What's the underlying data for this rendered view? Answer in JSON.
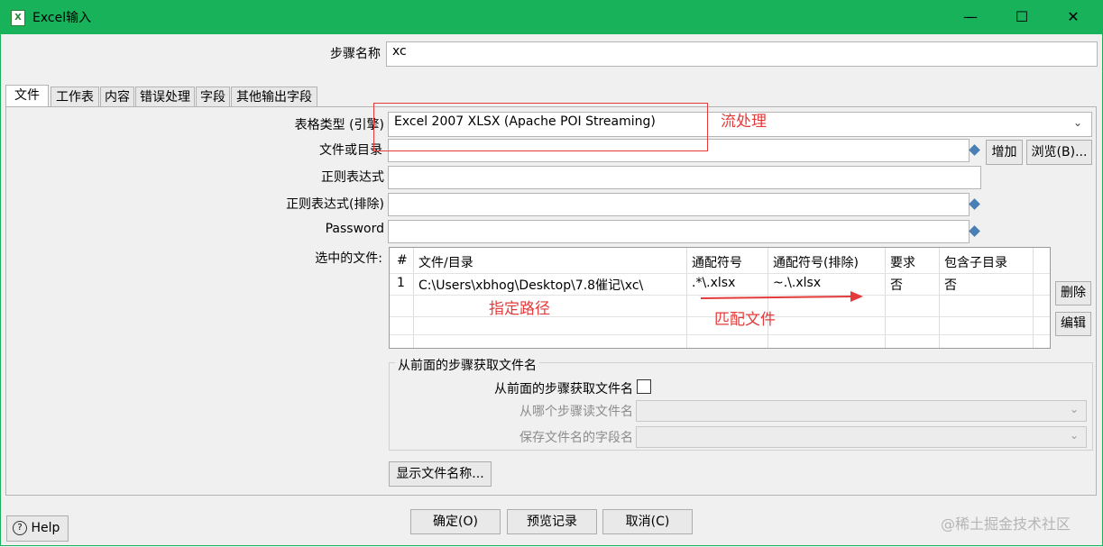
{
  "window": {
    "title": "Excel输入",
    "min": "—",
    "max": "☐",
    "close": "✕",
    "app_icon": "X"
  },
  "step_name": {
    "label": "步骤名称",
    "value": "xc"
  },
  "tabs": [
    "文件",
    "工作表",
    "内容",
    "错误处理",
    "字段",
    "其他输出字段"
  ],
  "form": {
    "spreadsheet_type_label": "表格类型 (引擎)",
    "spreadsheet_type_value": "Excel 2007 XLSX (Apache POI Streaming)",
    "file_or_dir_label": "文件或目录",
    "add_button": "增加",
    "browse_button": "浏览(B)...",
    "regex_label": "正则表达式",
    "regex_exclude_label": "正则表达式(排除)",
    "password_label": "Password",
    "selected_files_label": "选中的文件:"
  },
  "table": {
    "headers": [
      "#",
      "文件/目录",
      "通配符号",
      "通配符号(排除)",
      "要求",
      "包含子目录"
    ],
    "rows": [
      [
        "1",
        "C:\\Users\\xbhog\\Desktop\\7.8催记\\xc\\",
        ".*\\.xlsx",
        "~.\\.xlsx",
        "否",
        "否"
      ]
    ],
    "delete_button": "删除",
    "edit_button": "编辑"
  },
  "prev_step": {
    "group_title": "从前面的步骤获取文件名",
    "checkbox_label": "从前面的步骤获取文件名",
    "read_from_label": "从哪个步骤读文件名",
    "field_name_label": "保存文件名的字段名"
  },
  "show_files_button": "显示文件名称...",
  "footer": {
    "help": "Help",
    "ok": "确定(O)",
    "preview": "预览记录",
    "cancel": "取消(C)",
    "watermark": "@稀土掘金技术社区"
  },
  "annotations": {
    "stream": "流处理",
    "path": "指定路径",
    "match": "匹配文件",
    "color": "#e33b3b"
  }
}
